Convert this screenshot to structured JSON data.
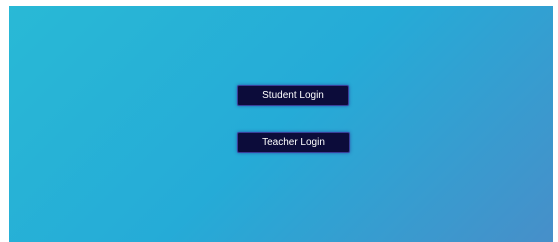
{
  "login": {
    "student_label": "Student Login",
    "teacher_label": "Teacher Login"
  },
  "colors": {
    "background_gradient": [
      "#29b9d6",
      "#25abd7",
      "#478fc9"
    ],
    "button_background": "#0c0c3a",
    "button_border": "#3a3f9a",
    "button_text": "#ffffff"
  }
}
